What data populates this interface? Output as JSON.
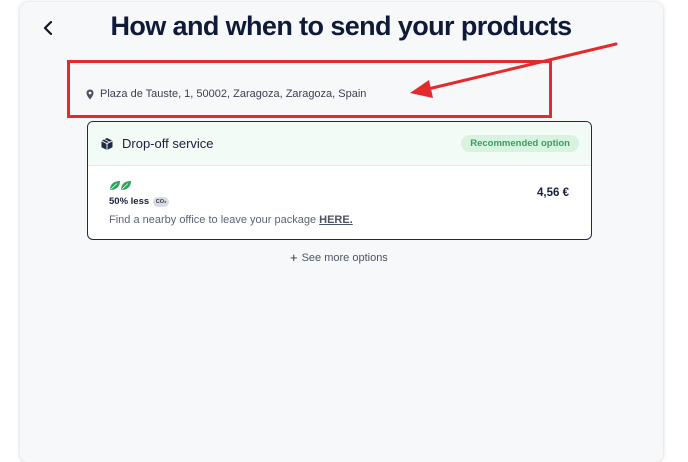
{
  "page": {
    "title": "How and when to send your products"
  },
  "address": {
    "text": "Plaza de Tauste, 1, 50002, Zaragoza, Zaragoza, Spain"
  },
  "option": {
    "name": "Drop-off service",
    "badge": "Recommended option",
    "eco_label": "50% less",
    "co2_label": "CO₂",
    "description": "Find a nearby office to leave your package",
    "link_text": "HERE.",
    "price": "4,56 €"
  },
  "see_more": {
    "plus": "+",
    "label": "See more options"
  },
  "icons": {
    "back": "chevron-left-icon",
    "location": "map-pin-icon",
    "service": "package-box-icon",
    "eco": "leaf-icon"
  },
  "colors": {
    "title": "#0e1a38",
    "annotation": "#e32b2b",
    "badge_bg": "#d8f4e1",
    "badge_text": "#3b9d5e",
    "leaf": "#2fa35a"
  }
}
